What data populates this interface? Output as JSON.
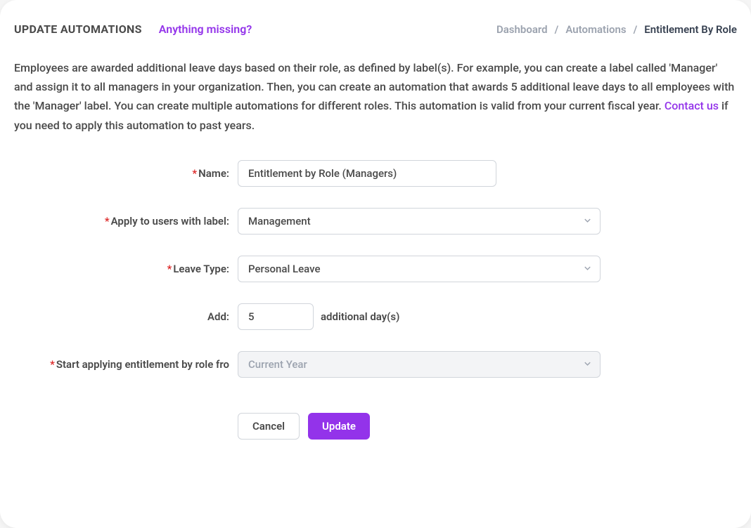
{
  "header": {
    "title": "UPDATE AUTOMATIONS",
    "missing_link": "Anything missing?"
  },
  "breadcrumb": {
    "dashboard": "Dashboard",
    "automations": "Automations",
    "current": "Entitlement By Role",
    "separator": "/"
  },
  "description": {
    "text_before": "Employees are awarded additional leave days based on their role, as defined by label(s). For example, you can create a label called 'Manager' and assign it to all managers in your organization. Then, you can create an automation that awards 5 additional leave days to all employees with the 'Manager' label. You can create multiple automations for different roles. This automation is valid from your current fiscal year. ",
    "contact_link": "Contact us",
    "text_after": " if you need to apply this automation to past years."
  },
  "form": {
    "name": {
      "label": "Name:",
      "value": "Entitlement by Role (Managers)"
    },
    "label_select": {
      "label": "Apply to users with label:",
      "value": "Management"
    },
    "leave_type": {
      "label": "Leave Type:",
      "value": "Personal Leave"
    },
    "add": {
      "label": "Add:",
      "value": "5",
      "suffix": "additional day(s)"
    },
    "start_from": {
      "label": "Start applying entitlement by role fro",
      "value": "Current Year"
    }
  },
  "buttons": {
    "cancel": "Cancel",
    "update": "Update"
  }
}
